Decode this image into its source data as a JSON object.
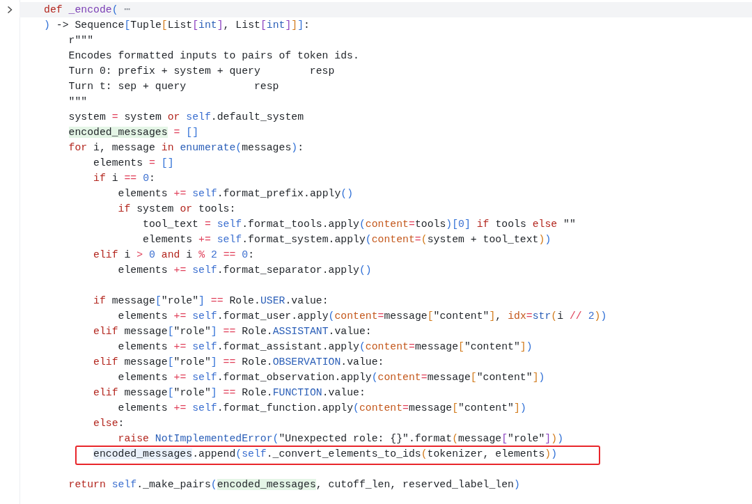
{
  "editor": {
    "lines": [
      {
        "kind": "code",
        "current": true,
        "folded": true,
        "boxed": false,
        "tokens": [
          {
            "text": "def",
            "kind": "keyword"
          },
          {
            "text": " _encode",
            "kind": "function"
          },
          {
            "text": "(",
            "kind": "bracket1"
          },
          {
            "text": " ⋯",
            "kind": "ellipsis"
          }
        ]
      },
      {
        "kind": "code",
        "current": false,
        "folded": false,
        "boxed": false,
        "tokens": [
          {
            "text": ")",
            "kind": "bracket1"
          },
          {
            "text": " -> Sequence",
            "kind": "plain"
          },
          {
            "text": "[",
            "kind": "bracket1"
          },
          {
            "text": "Tuple",
            "kind": "plain"
          },
          {
            "text": "[",
            "kind": "bracket2"
          },
          {
            "text": "List",
            "kind": "plain"
          },
          {
            "text": "[",
            "kind": "bracket3"
          },
          {
            "text": "int",
            "kind": "name"
          },
          {
            "text": "]",
            "kind": "bracket3"
          },
          {
            "text": ", List",
            "kind": "plain"
          },
          {
            "text": "[",
            "kind": "bracket3"
          },
          {
            "text": "int",
            "kind": "name"
          },
          {
            "text": "]",
            "kind": "bracket3"
          },
          {
            "text": "]",
            "kind": "bracket2"
          },
          {
            "text": "]",
            "kind": "bracket1"
          },
          {
            "text": ":",
            "kind": "plain"
          }
        ]
      },
      {
        "kind": "code",
        "current": false,
        "folded": false,
        "boxed": false,
        "tokens": [
          {
            "text": "    r\"\"\"",
            "kind": "plain"
          }
        ]
      },
      {
        "kind": "code",
        "current": false,
        "folded": false,
        "boxed": false,
        "tokens": [
          {
            "text": "    Encodes formatted inputs to pairs of token ids.",
            "kind": "plain"
          }
        ]
      },
      {
        "kind": "code",
        "current": false,
        "folded": false,
        "boxed": false,
        "tokens": [
          {
            "text": "    Turn 0: prefix + system + query        resp",
            "kind": "plain"
          }
        ]
      },
      {
        "kind": "code",
        "current": false,
        "folded": false,
        "boxed": false,
        "tokens": [
          {
            "text": "    Turn t: sep + query           resp",
            "kind": "plain"
          }
        ]
      },
      {
        "kind": "code",
        "current": false,
        "folded": false,
        "boxed": false,
        "tokens": [
          {
            "text": "    \"\"\"",
            "kind": "plain"
          }
        ]
      },
      {
        "kind": "code",
        "current": false,
        "folded": false,
        "boxed": false,
        "tokens": [
          {
            "text": "    system ",
            "kind": "plain"
          },
          {
            "text": "=",
            "kind": "operator"
          },
          {
            "text": " system ",
            "kind": "plain"
          },
          {
            "text": "or",
            "kind": "keyword"
          },
          {
            "text": " self",
            "kind": "self"
          },
          {
            "text": ".default_system",
            "kind": "plain"
          }
        ]
      },
      {
        "kind": "code",
        "current": false,
        "folded": false,
        "boxed": false,
        "tokens": [
          {
            "text": "    encoded_messages",
            "kind": "write_highlight"
          },
          {
            "text": " =",
            "kind": "operator"
          },
          {
            "text": " []",
            "kind": "bracket1"
          }
        ]
      },
      {
        "kind": "code",
        "current": false,
        "folded": false,
        "boxed": false,
        "tokens": [
          {
            "text": "    for",
            "kind": "keyword"
          },
          {
            "text": " i, message ",
            "kind": "plain"
          },
          {
            "text": "in",
            "kind": "keyword"
          },
          {
            "text": " enumerate",
            "kind": "name"
          },
          {
            "text": "(",
            "kind": "bracket1"
          },
          {
            "text": "messages",
            "kind": "plain"
          },
          {
            "text": ")",
            "kind": "bracket1"
          },
          {
            "text": ":",
            "kind": "plain"
          }
        ]
      },
      {
        "kind": "code",
        "current": false,
        "folded": false,
        "boxed": false,
        "tokens": [
          {
            "text": "        elements ",
            "kind": "plain"
          },
          {
            "text": "=",
            "kind": "operator"
          },
          {
            "text": " []",
            "kind": "bracket1"
          }
        ]
      },
      {
        "kind": "code",
        "current": false,
        "folded": false,
        "boxed": false,
        "tokens": [
          {
            "text": "        if",
            "kind": "keyword"
          },
          {
            "text": " i ",
            "kind": "plain"
          },
          {
            "text": "==",
            "kind": "operator"
          },
          {
            "text": " 0",
            "kind": "number"
          },
          {
            "text": ":",
            "kind": "plain"
          }
        ]
      },
      {
        "kind": "code",
        "current": false,
        "folded": false,
        "boxed": false,
        "tokens": [
          {
            "text": "            elements ",
            "kind": "plain"
          },
          {
            "text": "+=",
            "kind": "operator"
          },
          {
            "text": " self",
            "kind": "self"
          },
          {
            "text": ".format_prefix.apply",
            "kind": "plain"
          },
          {
            "text": "()",
            "kind": "bracket1"
          }
        ]
      },
      {
        "kind": "code",
        "current": false,
        "folded": false,
        "boxed": false,
        "tokens": [
          {
            "text": "            if",
            "kind": "keyword"
          },
          {
            "text": " system ",
            "kind": "plain"
          },
          {
            "text": "or",
            "kind": "keyword"
          },
          {
            "text": " tools:",
            "kind": "plain"
          }
        ]
      },
      {
        "kind": "code",
        "current": false,
        "folded": false,
        "boxed": false,
        "tokens": [
          {
            "text": "                tool_text ",
            "kind": "plain"
          },
          {
            "text": "=",
            "kind": "operator"
          },
          {
            "text": " self",
            "kind": "self"
          },
          {
            "text": ".format_tools.apply",
            "kind": "plain"
          },
          {
            "text": "(",
            "kind": "bracket1"
          },
          {
            "text": "content",
            "kind": "param"
          },
          {
            "text": "=",
            "kind": "operator"
          },
          {
            "text": "tools",
            "kind": "plain"
          },
          {
            "text": ")",
            "kind": "bracket1"
          },
          {
            "text": "[",
            "kind": "bracket1"
          },
          {
            "text": "0",
            "kind": "number"
          },
          {
            "text": "]",
            "kind": "bracket1"
          },
          {
            "text": " if",
            "kind": "keyword"
          },
          {
            "text": " tools ",
            "kind": "plain"
          },
          {
            "text": "else",
            "kind": "keyword"
          },
          {
            "text": " \"\"",
            "kind": "plain"
          }
        ]
      },
      {
        "kind": "code",
        "current": false,
        "folded": false,
        "boxed": false,
        "tokens": [
          {
            "text": "                elements ",
            "kind": "plain"
          },
          {
            "text": "+=",
            "kind": "operator"
          },
          {
            "text": " self",
            "kind": "self"
          },
          {
            "text": ".format_system.apply",
            "kind": "plain"
          },
          {
            "text": "(",
            "kind": "bracket1"
          },
          {
            "text": "content",
            "kind": "param"
          },
          {
            "text": "=",
            "kind": "operator"
          },
          {
            "text": "(",
            "kind": "bracket2"
          },
          {
            "text": "system + tool_text",
            "kind": "plain"
          },
          {
            "text": ")",
            "kind": "bracket2"
          },
          {
            "text": ")",
            "kind": "bracket1"
          }
        ]
      },
      {
        "kind": "code",
        "current": false,
        "folded": false,
        "boxed": false,
        "tokens": [
          {
            "text": "        elif",
            "kind": "keyword"
          },
          {
            "text": " i ",
            "kind": "plain"
          },
          {
            "text": ">",
            "kind": "operator"
          },
          {
            "text": " 0",
            "kind": "number"
          },
          {
            "text": " and",
            "kind": "keyword"
          },
          {
            "text": " i ",
            "kind": "plain"
          },
          {
            "text": "%",
            "kind": "operator"
          },
          {
            "text": " 2",
            "kind": "number"
          },
          {
            "text": " ==",
            "kind": "operator"
          },
          {
            "text": " 0",
            "kind": "number"
          },
          {
            "text": ":",
            "kind": "plain"
          }
        ]
      },
      {
        "kind": "code",
        "current": false,
        "folded": false,
        "boxed": false,
        "tokens": [
          {
            "text": "            elements ",
            "kind": "plain"
          },
          {
            "text": "+=",
            "kind": "operator"
          },
          {
            "text": " self",
            "kind": "self"
          },
          {
            "text": ".format_separator.apply",
            "kind": "plain"
          },
          {
            "text": "()",
            "kind": "bracket1"
          }
        ]
      },
      {
        "kind": "blank"
      },
      {
        "kind": "code",
        "current": false,
        "folded": false,
        "boxed": false,
        "tokens": [
          {
            "text": "        if",
            "kind": "keyword"
          },
          {
            "text": " message",
            "kind": "plain"
          },
          {
            "text": "[",
            "kind": "bracket1"
          },
          {
            "text": "\"role\"",
            "kind": "plain"
          },
          {
            "text": "]",
            "kind": "bracket1"
          },
          {
            "text": " ==",
            "kind": "operator"
          },
          {
            "text": " Role.",
            "kind": "plain"
          },
          {
            "text": "USER",
            "kind": "name"
          },
          {
            "text": ".value:",
            "kind": "plain"
          }
        ]
      },
      {
        "kind": "code",
        "current": false,
        "folded": false,
        "boxed": false,
        "tokens": [
          {
            "text": "            elements ",
            "kind": "plain"
          },
          {
            "text": "+=",
            "kind": "operator"
          },
          {
            "text": " self",
            "kind": "self"
          },
          {
            "text": ".format_user.apply",
            "kind": "plain"
          },
          {
            "text": "(",
            "kind": "bracket1"
          },
          {
            "text": "content",
            "kind": "param"
          },
          {
            "text": "=",
            "kind": "operator"
          },
          {
            "text": "message",
            "kind": "plain"
          },
          {
            "text": "[",
            "kind": "bracket2"
          },
          {
            "text": "\"content\"",
            "kind": "plain"
          },
          {
            "text": "]",
            "kind": "bracket2"
          },
          {
            "text": ", ",
            "kind": "plain"
          },
          {
            "text": "idx",
            "kind": "param"
          },
          {
            "text": "=",
            "kind": "operator"
          },
          {
            "text": "str",
            "kind": "name"
          },
          {
            "text": "(",
            "kind": "bracket2"
          },
          {
            "text": "i ",
            "kind": "plain"
          },
          {
            "text": "//",
            "kind": "operator"
          },
          {
            "text": " 2",
            "kind": "number"
          },
          {
            "text": ")",
            "kind": "bracket2"
          },
          {
            "text": ")",
            "kind": "bracket1"
          }
        ]
      },
      {
        "kind": "code",
        "current": false,
        "folded": false,
        "boxed": false,
        "tokens": [
          {
            "text": "        elif",
            "kind": "keyword"
          },
          {
            "text": " message",
            "kind": "plain"
          },
          {
            "text": "[",
            "kind": "bracket1"
          },
          {
            "text": "\"role\"",
            "kind": "plain"
          },
          {
            "text": "]",
            "kind": "bracket1"
          },
          {
            "text": " ==",
            "kind": "operator"
          },
          {
            "text": " Role.",
            "kind": "plain"
          },
          {
            "text": "ASSISTANT",
            "kind": "name"
          },
          {
            "text": ".value:",
            "kind": "plain"
          }
        ]
      },
      {
        "kind": "code",
        "current": false,
        "folded": false,
        "boxed": false,
        "tokens": [
          {
            "text": "            elements ",
            "kind": "plain"
          },
          {
            "text": "+=",
            "kind": "operator"
          },
          {
            "text": " self",
            "kind": "self"
          },
          {
            "text": ".format_assistant.apply",
            "kind": "plain"
          },
          {
            "text": "(",
            "kind": "bracket1"
          },
          {
            "text": "content",
            "kind": "param"
          },
          {
            "text": "=",
            "kind": "operator"
          },
          {
            "text": "message",
            "kind": "plain"
          },
          {
            "text": "[",
            "kind": "bracket2"
          },
          {
            "text": "\"content\"",
            "kind": "plain"
          },
          {
            "text": "]",
            "kind": "bracket2"
          },
          {
            "text": ")",
            "kind": "bracket1"
          }
        ]
      },
      {
        "kind": "code",
        "current": false,
        "folded": false,
        "boxed": false,
        "tokens": [
          {
            "text": "        elif",
            "kind": "keyword"
          },
          {
            "text": " message",
            "kind": "plain"
          },
          {
            "text": "[",
            "kind": "bracket1"
          },
          {
            "text": "\"role\"",
            "kind": "plain"
          },
          {
            "text": "]",
            "kind": "bracket1"
          },
          {
            "text": " ==",
            "kind": "operator"
          },
          {
            "text": " Role.",
            "kind": "plain"
          },
          {
            "text": "OBSERVATION",
            "kind": "name"
          },
          {
            "text": ".value:",
            "kind": "plain"
          }
        ]
      },
      {
        "kind": "code",
        "current": false,
        "folded": false,
        "boxed": false,
        "tokens": [
          {
            "text": "            elements ",
            "kind": "plain"
          },
          {
            "text": "+=",
            "kind": "operator"
          },
          {
            "text": " self",
            "kind": "self"
          },
          {
            "text": ".format_observation.apply",
            "kind": "plain"
          },
          {
            "text": "(",
            "kind": "bracket1"
          },
          {
            "text": "content",
            "kind": "param"
          },
          {
            "text": "=",
            "kind": "operator"
          },
          {
            "text": "message",
            "kind": "plain"
          },
          {
            "text": "[",
            "kind": "bracket2"
          },
          {
            "text": "\"content\"",
            "kind": "plain"
          },
          {
            "text": "]",
            "kind": "bracket2"
          },
          {
            "text": ")",
            "kind": "bracket1"
          }
        ]
      },
      {
        "kind": "code",
        "current": false,
        "folded": false,
        "boxed": false,
        "tokens": [
          {
            "text": "        elif",
            "kind": "keyword"
          },
          {
            "text": " message",
            "kind": "plain"
          },
          {
            "text": "[",
            "kind": "bracket1"
          },
          {
            "text": "\"role\"",
            "kind": "plain"
          },
          {
            "text": "]",
            "kind": "bracket1"
          },
          {
            "text": " ==",
            "kind": "operator"
          },
          {
            "text": " Role.",
            "kind": "plain"
          },
          {
            "text": "FUNCTION",
            "kind": "name"
          },
          {
            "text": ".value:",
            "kind": "plain"
          }
        ]
      },
      {
        "kind": "code",
        "current": false,
        "folded": false,
        "boxed": false,
        "tokens": [
          {
            "text": "            elements ",
            "kind": "plain"
          },
          {
            "text": "+=",
            "kind": "operator"
          },
          {
            "text": " self",
            "kind": "self"
          },
          {
            "text": ".format_function.apply",
            "kind": "plain"
          },
          {
            "text": "(",
            "kind": "bracket1"
          },
          {
            "text": "content",
            "kind": "param"
          },
          {
            "text": "=",
            "kind": "operator"
          },
          {
            "text": "message",
            "kind": "plain"
          },
          {
            "text": "[",
            "kind": "bracket2"
          },
          {
            "text": "\"content\"",
            "kind": "plain"
          },
          {
            "text": "]",
            "kind": "bracket2"
          },
          {
            "text": ")",
            "kind": "bracket1"
          }
        ]
      },
      {
        "kind": "code",
        "current": false,
        "folded": false,
        "boxed": false,
        "tokens": [
          {
            "text": "        else",
            "kind": "keyword"
          },
          {
            "text": ":",
            "kind": "plain"
          }
        ]
      },
      {
        "kind": "code",
        "current": false,
        "folded": false,
        "boxed": false,
        "tokens": [
          {
            "text": "            raise",
            "kind": "keyword"
          },
          {
            "text": " NotImplementedError",
            "kind": "name"
          },
          {
            "text": "(",
            "kind": "bracket1"
          },
          {
            "text": "\"Unexpected role: {}\"",
            "kind": "plain"
          },
          {
            "text": ".format",
            "kind": "plain"
          },
          {
            "text": "(",
            "kind": "bracket2"
          },
          {
            "text": "message",
            "kind": "plain"
          },
          {
            "text": "[",
            "kind": "bracket3"
          },
          {
            "text": "\"role\"",
            "kind": "plain"
          },
          {
            "text": "]",
            "kind": "bracket3"
          },
          {
            "text": ")",
            "kind": "bracket2"
          },
          {
            "text": ")",
            "kind": "bracket1"
          }
        ]
      },
      {
        "kind": "code",
        "current": false,
        "folded": false,
        "boxed": true,
        "tokens": [
          {
            "text": "        encoded_messages",
            "kind": "read_highlight"
          },
          {
            "text": ".append",
            "kind": "plain"
          },
          {
            "text": "(",
            "kind": "bracket1"
          },
          {
            "text": "self",
            "kind": "self"
          },
          {
            "text": "._convert_elements_to_ids",
            "kind": "plain"
          },
          {
            "text": "(",
            "kind": "bracket2"
          },
          {
            "text": "tokenizer, elements",
            "kind": "plain"
          },
          {
            "text": ")",
            "kind": "bracket2"
          },
          {
            "text": ")",
            "kind": "bracket1"
          }
        ]
      },
      {
        "kind": "blank"
      },
      {
        "kind": "code",
        "current": false,
        "folded": false,
        "boxed": false,
        "tokens": [
          {
            "text": "    return",
            "kind": "keyword"
          },
          {
            "text": " self",
            "kind": "self"
          },
          {
            "text": "._make_pairs",
            "kind": "plain"
          },
          {
            "text": "(",
            "kind": "bracket1"
          },
          {
            "text": "encoded_messages",
            "kind": "write_highlight"
          },
          {
            "text": ", cutoff_len, reserved_label_len",
            "kind": "plain"
          },
          {
            "text": ")",
            "kind": "bracket1"
          }
        ]
      }
    ]
  }
}
